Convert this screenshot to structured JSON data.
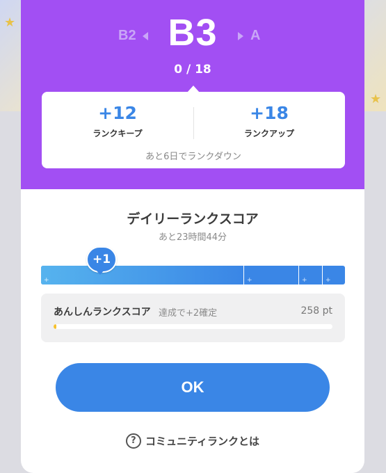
{
  "colors": {
    "header_purple": "#a24ff3",
    "accent_blue": "#3a86e6",
    "safe_fill_yellow": "#f6c12e"
  },
  "rank": {
    "previous": "B2",
    "current": "B3",
    "next": "A",
    "progress_text": "0 / 18",
    "progress_current": 0,
    "progress_target": 18
  },
  "card": {
    "keep_points": "+12",
    "keep_label": "ランクキープ",
    "up_points": "+18",
    "up_label": "ランクアップ",
    "note": "あと6日でランクダウン"
  },
  "daily": {
    "title": "デイリーランクスコア",
    "subtitle": "あと23時間44分",
    "bubble": "+1",
    "tick_symbol": "+"
  },
  "safe_score": {
    "title": "あんしんランクスコア",
    "condition": "達成で+2確定",
    "value": "258 pt"
  },
  "ok_label": "OK",
  "help": {
    "icon": "question-circle-icon",
    "glyph": "?",
    "label": "コミュニティランクとは"
  }
}
